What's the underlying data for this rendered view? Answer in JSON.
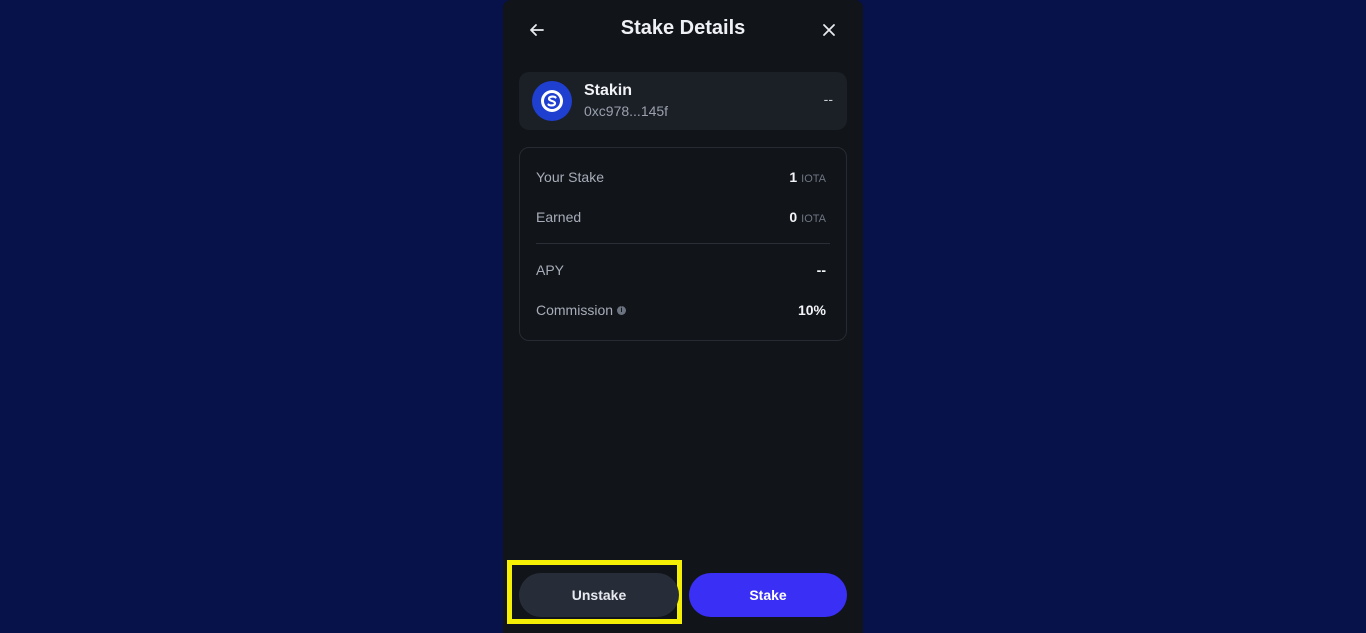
{
  "header": {
    "title": "Stake Details"
  },
  "validator": {
    "name": "Stakin",
    "address": "0xc978...145f",
    "value": "--"
  },
  "details": {
    "your_stake_label": "Your Stake",
    "your_stake_value": "1",
    "your_stake_unit": "IOTA",
    "earned_label": "Earned",
    "earned_value": "0",
    "earned_unit": "IOTA",
    "apy_label": "APY",
    "apy_value": "--",
    "commission_label": "Commission",
    "commission_value": "10%"
  },
  "actions": {
    "unstake_label": "Unstake",
    "stake_label": "Stake"
  },
  "colors": {
    "page_background": "#07114a",
    "panel_background": "#111419",
    "primary_button": "#3a2ff5",
    "highlight": "#f5ef06"
  }
}
